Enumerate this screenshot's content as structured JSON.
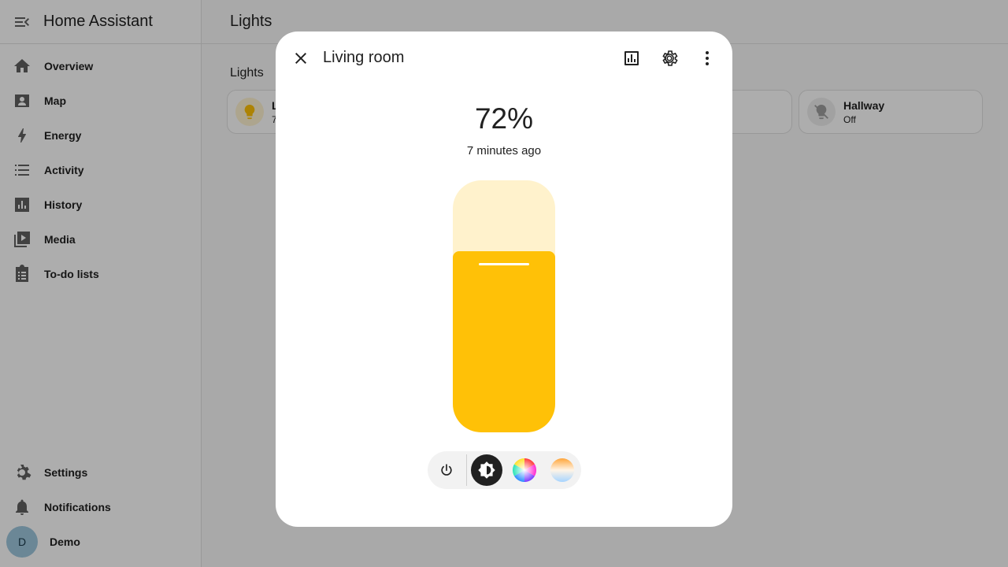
{
  "app": {
    "title": "Home Assistant"
  },
  "sidebar": {
    "items": [
      {
        "label": "Overview",
        "icon": "home-icon"
      },
      {
        "label": "Map",
        "icon": "map-icon"
      },
      {
        "label": "Energy",
        "icon": "lightning-icon"
      },
      {
        "label": "Activity",
        "icon": "list-icon"
      },
      {
        "label": "History",
        "icon": "chart-icon"
      },
      {
        "label": "Media",
        "icon": "media-icon"
      },
      {
        "label": "To-do lists",
        "icon": "clipboard-icon"
      }
    ],
    "bottom": [
      {
        "label": "Settings",
        "icon": "gear-icon"
      },
      {
        "label": "Notifications",
        "icon": "bell-icon"
      }
    ],
    "user": {
      "initial": "D",
      "name": "Demo"
    }
  },
  "main": {
    "title": "Lights",
    "section_title": "Lights",
    "tiles": [
      {
        "name": "L",
        "state": "7",
        "icon": "lightbulb-icon"
      },
      {
        "name": "Hallway",
        "state": "Off",
        "icon": "lightbulb-off-icon"
      }
    ]
  },
  "dialog": {
    "title": "Living room",
    "state": "72%",
    "last_changed": "7 minutes ago",
    "brightness": 72,
    "colors": {
      "fill": "#ffc107",
      "track": "#fff2cc"
    },
    "header_icons": [
      "close-icon",
      "history-chart-icon",
      "gear-icon",
      "more-vertical-icon"
    ],
    "controls": [
      "power-icon",
      "brightness-icon",
      "color-wheel-icon",
      "color-temperature-icon"
    ]
  }
}
